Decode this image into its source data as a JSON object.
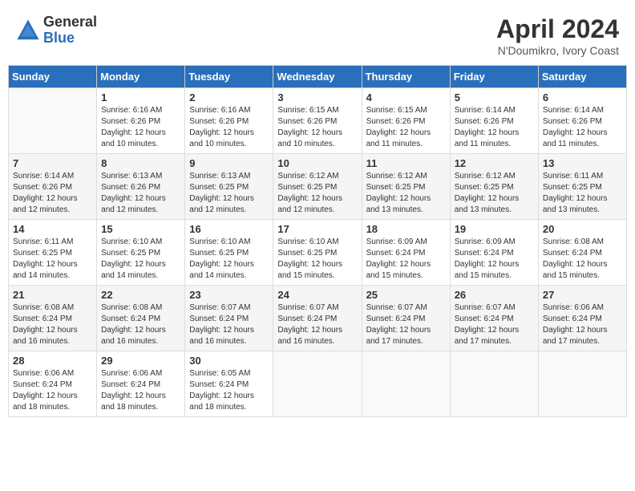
{
  "logo": {
    "general": "General",
    "blue": "Blue"
  },
  "title": "April 2024",
  "location": "N'Doumikro, Ivory Coast",
  "days_header": [
    "Sunday",
    "Monday",
    "Tuesday",
    "Wednesday",
    "Thursday",
    "Friday",
    "Saturday"
  ],
  "weeks": [
    [
      {
        "day": "",
        "info": ""
      },
      {
        "day": "1",
        "info": "Sunrise: 6:16 AM\nSunset: 6:26 PM\nDaylight: 12 hours\nand 10 minutes."
      },
      {
        "day": "2",
        "info": "Sunrise: 6:16 AM\nSunset: 6:26 PM\nDaylight: 12 hours\nand 10 minutes."
      },
      {
        "day": "3",
        "info": "Sunrise: 6:15 AM\nSunset: 6:26 PM\nDaylight: 12 hours\nand 10 minutes."
      },
      {
        "day": "4",
        "info": "Sunrise: 6:15 AM\nSunset: 6:26 PM\nDaylight: 12 hours\nand 11 minutes."
      },
      {
        "day": "5",
        "info": "Sunrise: 6:14 AM\nSunset: 6:26 PM\nDaylight: 12 hours\nand 11 minutes."
      },
      {
        "day": "6",
        "info": "Sunrise: 6:14 AM\nSunset: 6:26 PM\nDaylight: 12 hours\nand 11 minutes."
      }
    ],
    [
      {
        "day": "7",
        "info": "Sunrise: 6:14 AM\nSunset: 6:26 PM\nDaylight: 12 hours\nand 12 minutes."
      },
      {
        "day": "8",
        "info": "Sunrise: 6:13 AM\nSunset: 6:26 PM\nDaylight: 12 hours\nand 12 minutes."
      },
      {
        "day": "9",
        "info": "Sunrise: 6:13 AM\nSunset: 6:25 PM\nDaylight: 12 hours\nand 12 minutes."
      },
      {
        "day": "10",
        "info": "Sunrise: 6:12 AM\nSunset: 6:25 PM\nDaylight: 12 hours\nand 12 minutes."
      },
      {
        "day": "11",
        "info": "Sunrise: 6:12 AM\nSunset: 6:25 PM\nDaylight: 12 hours\nand 13 minutes."
      },
      {
        "day": "12",
        "info": "Sunrise: 6:12 AM\nSunset: 6:25 PM\nDaylight: 12 hours\nand 13 minutes."
      },
      {
        "day": "13",
        "info": "Sunrise: 6:11 AM\nSunset: 6:25 PM\nDaylight: 12 hours\nand 13 minutes."
      }
    ],
    [
      {
        "day": "14",
        "info": "Sunrise: 6:11 AM\nSunset: 6:25 PM\nDaylight: 12 hours\nand 14 minutes."
      },
      {
        "day": "15",
        "info": "Sunrise: 6:10 AM\nSunset: 6:25 PM\nDaylight: 12 hours\nand 14 minutes."
      },
      {
        "day": "16",
        "info": "Sunrise: 6:10 AM\nSunset: 6:25 PM\nDaylight: 12 hours\nand 14 minutes."
      },
      {
        "day": "17",
        "info": "Sunrise: 6:10 AM\nSunset: 6:25 PM\nDaylight: 12 hours\nand 15 minutes."
      },
      {
        "day": "18",
        "info": "Sunrise: 6:09 AM\nSunset: 6:24 PM\nDaylight: 12 hours\nand 15 minutes."
      },
      {
        "day": "19",
        "info": "Sunrise: 6:09 AM\nSunset: 6:24 PM\nDaylight: 12 hours\nand 15 minutes."
      },
      {
        "day": "20",
        "info": "Sunrise: 6:08 AM\nSunset: 6:24 PM\nDaylight: 12 hours\nand 15 minutes."
      }
    ],
    [
      {
        "day": "21",
        "info": "Sunrise: 6:08 AM\nSunset: 6:24 PM\nDaylight: 12 hours\nand 16 minutes."
      },
      {
        "day": "22",
        "info": "Sunrise: 6:08 AM\nSunset: 6:24 PM\nDaylight: 12 hours\nand 16 minutes."
      },
      {
        "day": "23",
        "info": "Sunrise: 6:07 AM\nSunset: 6:24 PM\nDaylight: 12 hours\nand 16 minutes."
      },
      {
        "day": "24",
        "info": "Sunrise: 6:07 AM\nSunset: 6:24 PM\nDaylight: 12 hours\nand 16 minutes."
      },
      {
        "day": "25",
        "info": "Sunrise: 6:07 AM\nSunset: 6:24 PM\nDaylight: 12 hours\nand 17 minutes."
      },
      {
        "day": "26",
        "info": "Sunrise: 6:07 AM\nSunset: 6:24 PM\nDaylight: 12 hours\nand 17 minutes."
      },
      {
        "day": "27",
        "info": "Sunrise: 6:06 AM\nSunset: 6:24 PM\nDaylight: 12 hours\nand 17 minutes."
      }
    ],
    [
      {
        "day": "28",
        "info": "Sunrise: 6:06 AM\nSunset: 6:24 PM\nDaylight: 12 hours\nand 18 minutes."
      },
      {
        "day": "29",
        "info": "Sunrise: 6:06 AM\nSunset: 6:24 PM\nDaylight: 12 hours\nand 18 minutes."
      },
      {
        "day": "30",
        "info": "Sunrise: 6:05 AM\nSunset: 6:24 PM\nDaylight: 12 hours\nand 18 minutes."
      },
      {
        "day": "",
        "info": ""
      },
      {
        "day": "",
        "info": ""
      },
      {
        "day": "",
        "info": ""
      },
      {
        "day": "",
        "info": ""
      }
    ]
  ]
}
